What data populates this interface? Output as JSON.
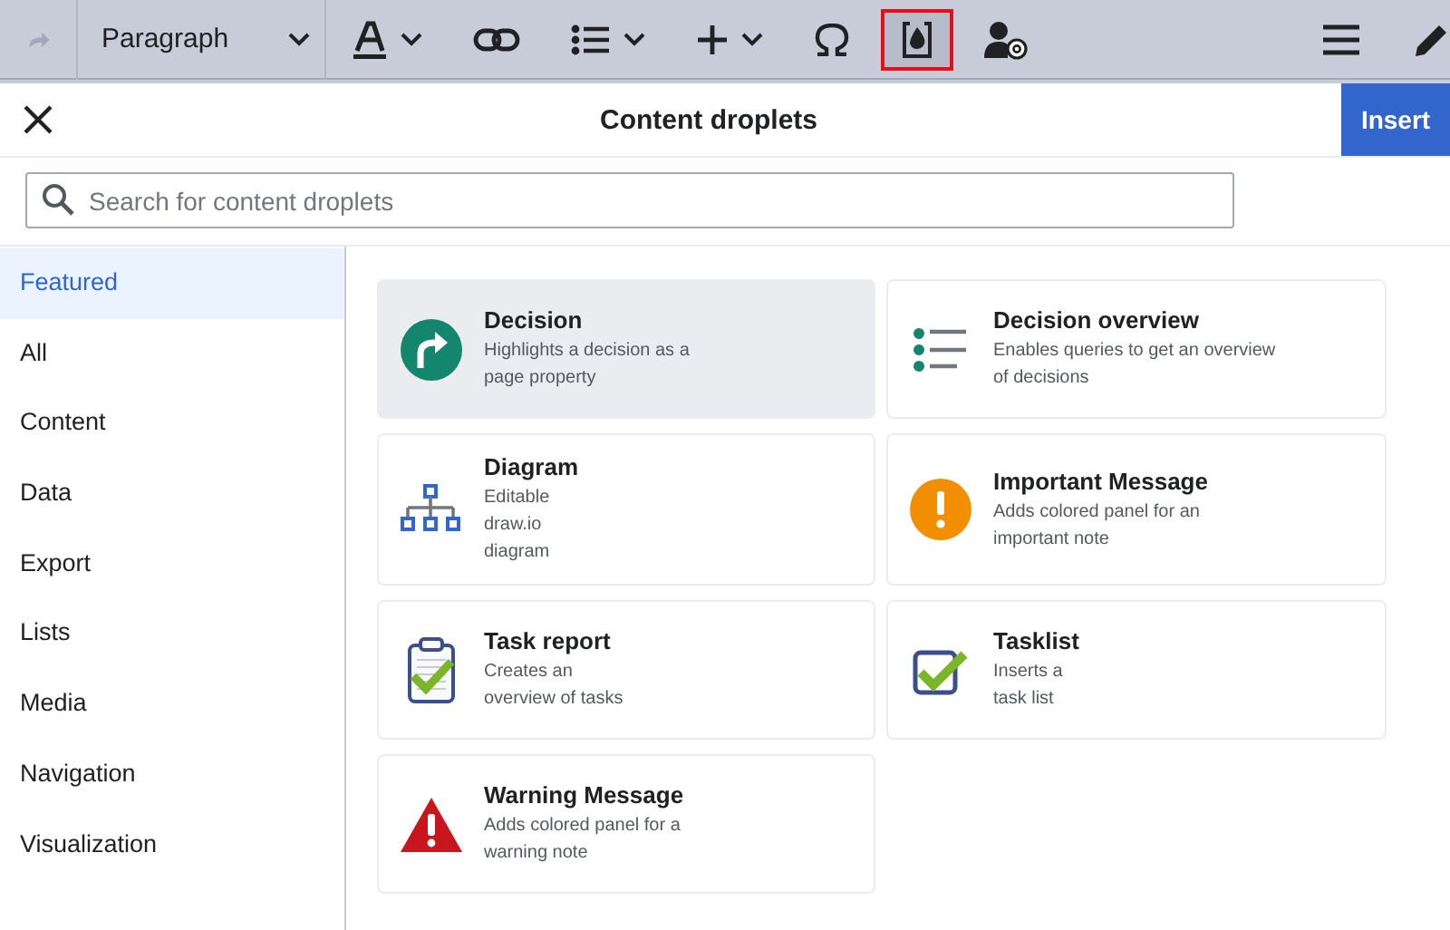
{
  "toolbar": {
    "format": {
      "value": "Paragraph"
    },
    "tools": [
      {
        "kind": "text-style",
        "caret": true,
        "selected": false
      },
      {
        "kind": "link",
        "caret": false,
        "selected": false
      },
      {
        "kind": "list",
        "caret": true,
        "selected": false
      },
      {
        "kind": "insert",
        "caret": true,
        "selected": false
      },
      {
        "kind": "special-character",
        "caret": false,
        "selected": false
      },
      {
        "kind": "droplet",
        "caret": false,
        "selected": true
      },
      {
        "kind": "mention",
        "caret": false,
        "selected": false
      }
    ]
  },
  "dialog": {
    "title": "Content droplets",
    "action": "Insert",
    "search": {
      "placeholder": "Search for content droplets"
    },
    "categories": [
      {
        "label": "Featured",
        "selected": true
      },
      {
        "label": "All",
        "selected": false
      },
      {
        "label": "Content",
        "selected": false
      },
      {
        "label": "Data",
        "selected": false
      },
      {
        "label": "Export",
        "selected": false
      },
      {
        "label": "Lists",
        "selected": false
      },
      {
        "label": "Media",
        "selected": false
      },
      {
        "label": "Navigation",
        "selected": false
      },
      {
        "label": "Visualization",
        "selected": false
      }
    ],
    "droplets": [
      {
        "kind": "decision",
        "title": "Decision",
        "description": [
          "Highlights a decision as a",
          "page property"
        ],
        "selected": true
      },
      {
        "kind": "overview",
        "title": "Decision overview",
        "description": [
          "Enables queries to get an overview",
          "of decisions"
        ],
        "selected": false
      },
      {
        "kind": "diagram",
        "title": "Diagram",
        "description": [
          "Editable",
          "draw.io",
          "diagram"
        ],
        "selected": false
      },
      {
        "kind": "important",
        "title": "Important Message",
        "description": [
          "Adds colored panel for an",
          "important note"
        ],
        "selected": false
      },
      {
        "kind": "taskreport",
        "title": "Task report",
        "description": [
          "Creates an",
          "overview of tasks"
        ],
        "selected": false
      },
      {
        "kind": "tasklist",
        "title": "Tasklist",
        "description": [
          "Inserts a",
          "task list"
        ],
        "selected": false
      },
      {
        "kind": "warning",
        "title": "Warning Message",
        "description": [
          "Adds colored panel for a",
          "warning note"
        ],
        "selected": false
      }
    ]
  }
}
